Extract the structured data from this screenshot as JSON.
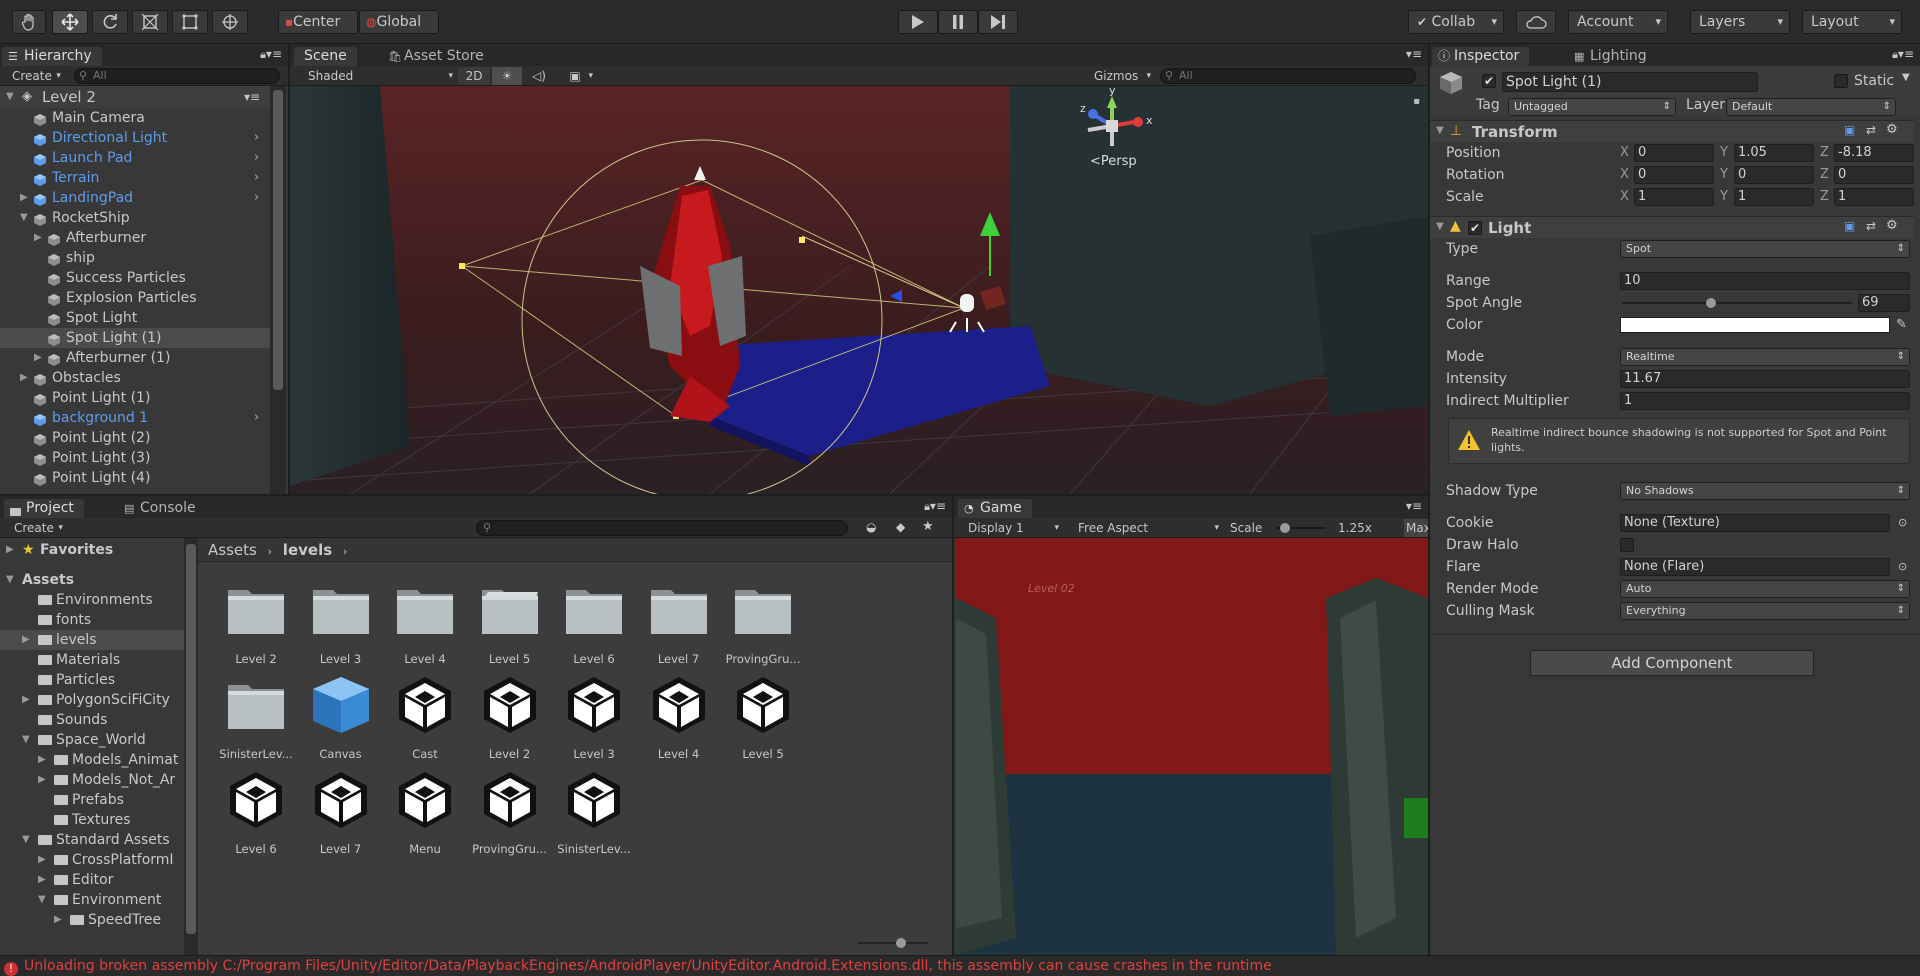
{
  "toolbar": {
    "tools": [
      "hand-tool",
      "move-tool",
      "rotate-tool",
      "scale-tool",
      "rect-tool",
      "transform-tool"
    ],
    "pivot": "Center",
    "space": "Global",
    "collab": "Collab",
    "account": "Account",
    "layers": "Layers",
    "layout": "Layout"
  },
  "hierarchy": {
    "tab": "Hierarchy",
    "create": "Create",
    "search_placeholder": "All",
    "scene_name": "Level 2",
    "items": [
      {
        "label": "Main Camera",
        "depth": 1,
        "color": "normal",
        "expander": "none",
        "chevron": false
      },
      {
        "label": "Directional Light",
        "depth": 1,
        "color": "blue",
        "expander": "none",
        "chevron": true
      },
      {
        "label": "Launch Pad",
        "depth": 1,
        "color": "blue",
        "expander": "none",
        "chevron": true
      },
      {
        "label": "Terrain",
        "depth": 1,
        "color": "blue",
        "expander": "none",
        "chevron": true
      },
      {
        "label": "LandingPad",
        "depth": 1,
        "color": "blue",
        "expander": "closed",
        "chevron": true
      },
      {
        "label": "RocketShip",
        "depth": 1,
        "color": "normal",
        "expander": "open",
        "chevron": false
      },
      {
        "label": "Afterburner",
        "depth": 2,
        "color": "normal",
        "expander": "closed",
        "chevron": false
      },
      {
        "label": "ship",
        "depth": 2,
        "color": "normal",
        "expander": "none",
        "chevron": false
      },
      {
        "label": "Success Particles",
        "depth": 2,
        "color": "normal",
        "expander": "none",
        "chevron": false
      },
      {
        "label": "Explosion Particles",
        "depth": 2,
        "color": "normal",
        "expander": "none",
        "chevron": false
      },
      {
        "label": "Spot Light",
        "depth": 2,
        "color": "normal",
        "expander": "none",
        "chevron": false
      },
      {
        "label": "Spot Light (1)",
        "depth": 2,
        "color": "normal",
        "expander": "none",
        "chevron": false,
        "selected": true
      },
      {
        "label": "Afterburner (1)",
        "depth": 2,
        "color": "normal",
        "expander": "closed",
        "chevron": false
      },
      {
        "label": "Obstacles",
        "depth": 1,
        "color": "normal",
        "expander": "closed",
        "chevron": false
      },
      {
        "label": "Point Light (1)",
        "depth": 1,
        "color": "normal",
        "expander": "none",
        "chevron": false
      },
      {
        "label": "background 1",
        "depth": 1,
        "color": "blue",
        "expander": "none",
        "chevron": true
      },
      {
        "label": "Point Light (2)",
        "depth": 1,
        "color": "normal",
        "expander": "none",
        "chevron": false
      },
      {
        "label": "Point Light (3)",
        "depth": 1,
        "color": "normal",
        "expander": "none",
        "chevron": false
      },
      {
        "label": "Point Light (4)",
        "depth": 1,
        "color": "normal",
        "expander": "none",
        "chevron": false
      }
    ]
  },
  "scene": {
    "tab": "Scene",
    "asset_store_tab": "Asset Store",
    "shading": "Shaded",
    "mode_2d": "2D",
    "gizmos": "Gizmos",
    "search_placeholder": "All",
    "persp": "Persp",
    "axis_y": "y",
    "axis_z": "z",
    "axis_x": "x"
  },
  "project": {
    "tab": "Project",
    "console_tab": "Console",
    "create": "Create",
    "breadcrumb": [
      "Assets",
      "levels"
    ],
    "tree": [
      {
        "label": "Favorites",
        "depth": 0,
        "expander": "closed",
        "bold": true,
        "star": true
      },
      {
        "label": "Assets",
        "depth": 0,
        "expander": "open",
        "bold": true
      },
      {
        "label": "Environments",
        "depth": 1,
        "expander": "none"
      },
      {
        "label": "fonts",
        "depth": 1,
        "expander": "none"
      },
      {
        "label": "levels",
        "depth": 1,
        "expander": "closed",
        "selected": true
      },
      {
        "label": "Materials",
        "depth": 1,
        "expander": "none"
      },
      {
        "label": "Particles",
        "depth": 1,
        "expander": "none"
      },
      {
        "label": "PolygonSciFiCity",
        "depth": 1,
        "expander": "closed"
      },
      {
        "label": "Sounds",
        "depth": 1,
        "expander": "none"
      },
      {
        "label": "Space_World",
        "depth": 1,
        "expander": "open"
      },
      {
        "label": "Models_Animat",
        "depth": 2,
        "expander": "closed"
      },
      {
        "label": "Models_Not_Ar",
        "depth": 2,
        "expander": "closed"
      },
      {
        "label": "Prefabs",
        "depth": 2,
        "expander": "none"
      },
      {
        "label": "Textures",
        "depth": 2,
        "expander": "none"
      },
      {
        "label": "Standard Assets",
        "depth": 1,
        "expander": "open"
      },
      {
        "label": "CrossPlatformI",
        "depth": 2,
        "expander": "closed"
      },
      {
        "label": "Editor",
        "depth": 2,
        "expander": "closed"
      },
      {
        "label": "Environment",
        "depth": 2,
        "expander": "open"
      },
      {
        "label": "SpeedTree",
        "depth": 3,
        "expander": "closed"
      }
    ],
    "assets": [
      {
        "label": "Level 2",
        "kind": "folder"
      },
      {
        "label": "Level 3",
        "kind": "folder"
      },
      {
        "label": "Level 4",
        "kind": "folder"
      },
      {
        "label": "Level 5",
        "kind": "folder-open"
      },
      {
        "label": "Level 6",
        "kind": "folder"
      },
      {
        "label": "Level 7",
        "kind": "folder"
      },
      {
        "label": "ProvingGru...",
        "kind": "folder"
      },
      {
        "label": "SinisterLev...",
        "kind": "folder"
      },
      {
        "label": "Canvas",
        "kind": "prefab"
      },
      {
        "label": "Cast",
        "kind": "unity"
      },
      {
        "label": "Level 2",
        "kind": "unity"
      },
      {
        "label": "Level 3",
        "kind": "unity"
      },
      {
        "label": "Level 4",
        "kind": "unity"
      },
      {
        "label": "Level 5",
        "kind": "unity"
      },
      {
        "label": "Level 6",
        "kind": "unity"
      },
      {
        "label": "Level 7",
        "kind": "unity"
      },
      {
        "label": "Menu",
        "kind": "unity"
      },
      {
        "label": "ProvingGru...",
        "kind": "unity"
      },
      {
        "label": "SinisterLev...",
        "kind": "unity"
      }
    ]
  },
  "game": {
    "tab": "Game",
    "display": "Display 1",
    "aspect": "Free Aspect",
    "scale_label": "Scale",
    "scale_value": "1.25x",
    "scale_fraction": 0.1,
    "maximize": "Max",
    "level_label": "Level 02"
  },
  "inspector": {
    "tab": "Inspector",
    "lighting_tab": "Lighting",
    "object_name": "Spot Light (1)",
    "active": true,
    "static_label": "Static",
    "tag_label": "Tag",
    "tag_value": "Untagged",
    "layer_label": "Layer",
    "layer_value": "Default",
    "transform": {
      "title": "Transform",
      "position_label": "Position",
      "rotation_label": "Rotation",
      "scale_label": "Scale",
      "position": [
        "0",
        "1.05",
        "-8.18"
      ],
      "rotation": [
        "0",
        "0",
        "0"
      ],
      "scale": [
        "1",
        "1",
        "1"
      ],
      "axes": [
        "X",
        "Y",
        "Z"
      ]
    },
    "light": {
      "title": "Light",
      "enabled": true,
      "type_label": "Type",
      "type_value": "Spot",
      "range_label": "Range",
      "range_value": "10",
      "spot_angle_label": "Spot Angle",
      "spot_angle_value": "69",
      "spot_angle_fraction": 0.38,
      "color_label": "Color",
      "color_value": "#ffffff",
      "mode_label": "Mode",
      "mode_value": "Realtime",
      "intensity_label": "Intensity",
      "intensity_value": "11.67",
      "indirect_label": "Indirect Multiplier",
      "indirect_value": "1",
      "warning_text": "Realtime indirect bounce shadowing is not supported for Spot and Point lights.",
      "shadow_label": "Shadow Type",
      "shadow_value": "No Shadows",
      "cookie_label": "Cookie",
      "cookie_value": "None (Texture)",
      "halo_label": "Draw Halo",
      "flare_label": "Flare",
      "flare_value": "None (Flare)",
      "render_mode_label": "Render Mode",
      "render_mode_value": "Auto",
      "culling_label": "Culling Mask",
      "culling_value": "Everything"
    },
    "add_component": "Add Component"
  },
  "status": {
    "message": "Unloading broken assembly C:/Program Files/Unity/Editor/Data/PlaybackEngines/AndroidPlayer/UnityEditor.Android.Extensions.dll, this assembly can cause crashes in the runtime"
  }
}
